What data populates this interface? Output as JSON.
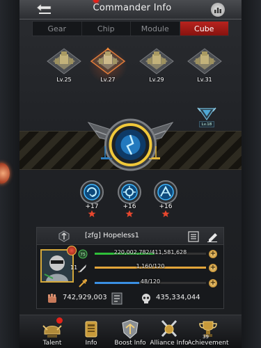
{
  "header": {
    "title": "Commander Info"
  },
  "tabs": [
    {
      "label": "Gear",
      "active": false
    },
    {
      "label": "Chip",
      "active": false,
      "notification": true
    },
    {
      "label": "Module",
      "active": false
    },
    {
      "label": "Cube",
      "active": true
    }
  ],
  "cubes": [
    {
      "level": "Lv.25",
      "selected": false
    },
    {
      "level": "Lv.27",
      "selected": true
    },
    {
      "level": "Lv.29",
      "selected": false
    },
    {
      "level": "Lv.31",
      "selected": false
    }
  ],
  "side_badge": {
    "level": "Lv.18"
  },
  "skills": [
    {
      "value": "+17"
    },
    {
      "value": "+16"
    },
    {
      "value": "+16"
    }
  ],
  "commander": {
    "name": "[zfg]  Hopeless1",
    "level": "11",
    "stats": [
      {
        "icon": "experience-icon",
        "text": "220,002,782/411,581,628",
        "fill": 0.535,
        "color": "#2fbf3a"
      },
      {
        "icon": "missile-icon",
        "text": "1,160/120",
        "fill": 1.0,
        "color": "#e2a53a"
      },
      {
        "icon": "energy-icon",
        "text": "48/120",
        "fill": 0.4,
        "color": "#3a8fe2"
      }
    ],
    "power": "742,929,003",
    "kills": "435,334,044"
  },
  "nav": [
    {
      "label": "Talent",
      "notification": true
    },
    {
      "label": "Info"
    },
    {
      "label": "Boost Info"
    },
    {
      "label": "Alliance Info"
    },
    {
      "label": "Achievement",
      "count": "39"
    }
  ],
  "colors": {
    "accent_red": "#b8231e",
    "gold": "#d4a83a",
    "cube_blue": "#3fb7ff"
  }
}
